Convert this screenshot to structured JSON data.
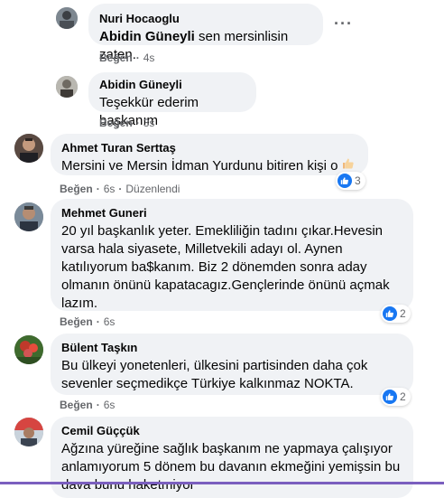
{
  "comments": [
    {
      "author": "Nuri Hocaoglu",
      "mention": "Abidin Güneyli",
      "text": " sen mersinlisin zaten.",
      "like_label": "Beğen",
      "time": "4s"
    },
    {
      "author": "Abidin Güneyli",
      "text": "Teşekkür ederim başkanım",
      "like_label": "Beğen",
      "time": "3s"
    },
    {
      "author": "Ahmet Turan Serttaş",
      "text": "Mersini ve Mersin İdman Yurdunu bitiren kişi o",
      "like_label": "Beğen",
      "time": "6s",
      "edited": "Düzenlendi",
      "reaction_count": "3"
    },
    {
      "author": "Mehmet Guneri",
      "text_lines": [
        "20 yıl başkanlık yeter. Emekliliğin tadını çıkar.Hevesin",
        "varsa hala siyasete, Milletvekili adayı ol. Aynen",
        "katılıyorum ba$kanım. Biz 2 dönemden sonra aday",
        "olmanın önünü kapatacagız.Gençlerinde önünü açmak",
        "lazım."
      ],
      "like_label": "Beğen",
      "time": "6s",
      "reaction_count": "2"
    },
    {
      "author": "Bülent Taşkın",
      "text_lines": [
        "Bu ülkeyi yonetenleri, ülkesini partisinden daha çok",
        "sevenler seçmedikçe Türkiye kalkınmaz NOKTA."
      ],
      "like_label": "Beğen",
      "time": "6s",
      "reaction_count": "2"
    },
    {
      "author": "Cemil Güççük",
      "text_lines": [
        "Ağzına yüreğine sağlık başkanım ne yapmaya çalışıyor",
        "anlamıyorum 5 dönem bu davanın ekmeğini yemişsin bu",
        "dava bunu haketmiyor"
      ]
    }
  ],
  "colors": {
    "bubble": "#f0f2f5",
    "meta": "#65676b",
    "like_blue": "#1877f2"
  },
  "icons": [
    "more-options-icon",
    "thumbs-up-emoji",
    "like-reaction-icon"
  ]
}
